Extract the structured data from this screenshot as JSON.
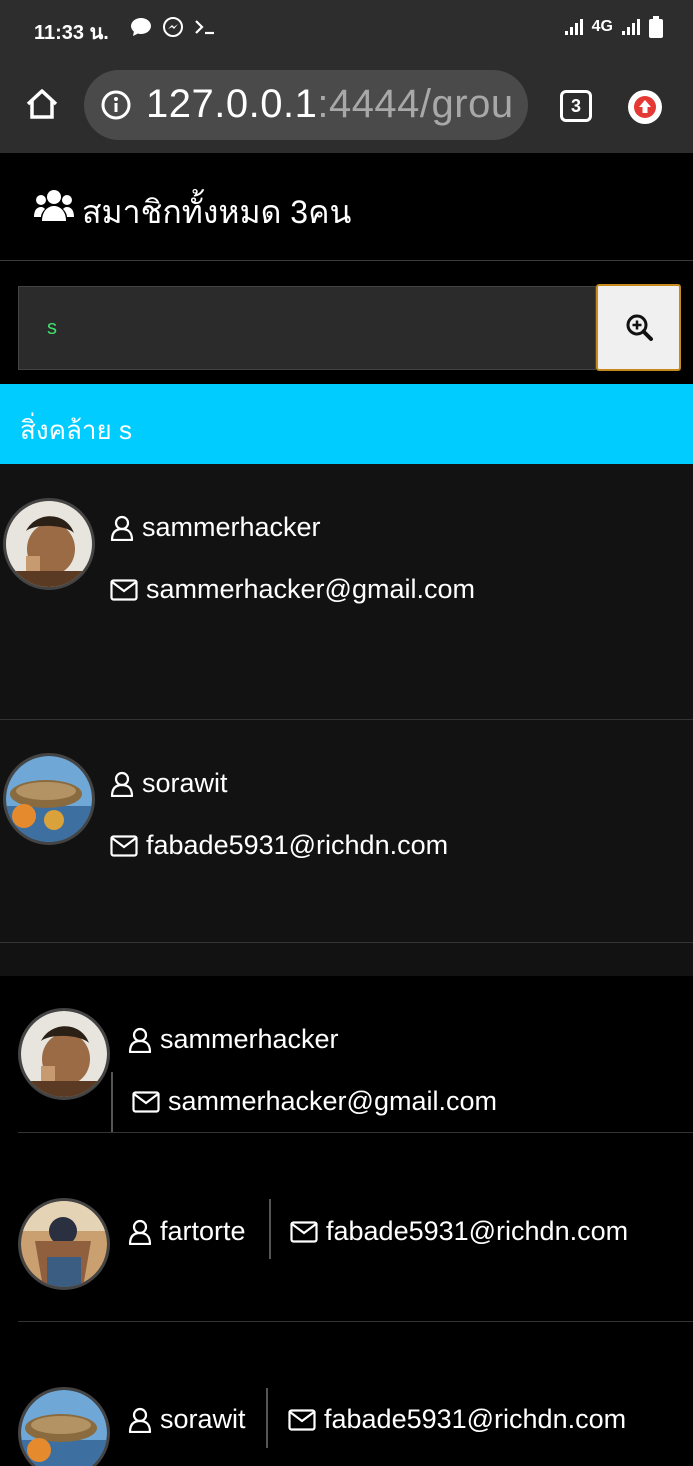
{
  "status_bar": {
    "time": "11:33 น.",
    "network": "4G"
  },
  "browser": {
    "url_host": "127.0.0.1",
    "url_rest": ":4444/grou",
    "tab_count": "3"
  },
  "header": {
    "title": "สมาชิกทั้งหมด 3คน",
    "icon": "users-icon"
  },
  "search": {
    "value": "s",
    "button_icon": "zoom-in-icon"
  },
  "similar": {
    "label": "สิ่งคล้าย s"
  },
  "results": [
    {
      "username": "sammerhacker",
      "email": "sammerhacker@gmail.com"
    },
    {
      "username": "sorawit",
      "email": "fabade5931@richdn.com"
    }
  ],
  "members": [
    {
      "username": "sammerhacker",
      "email": "sammerhacker@gmail.com"
    },
    {
      "username": "fartorte",
      "email": "fabade5931@richdn.com"
    },
    {
      "username": "sorawit",
      "email": "fabade5931@richdn.com"
    }
  ],
  "colors": {
    "accent": "#00ccff",
    "search_text": "#3ee06b",
    "search_border": "#c68a1c"
  }
}
